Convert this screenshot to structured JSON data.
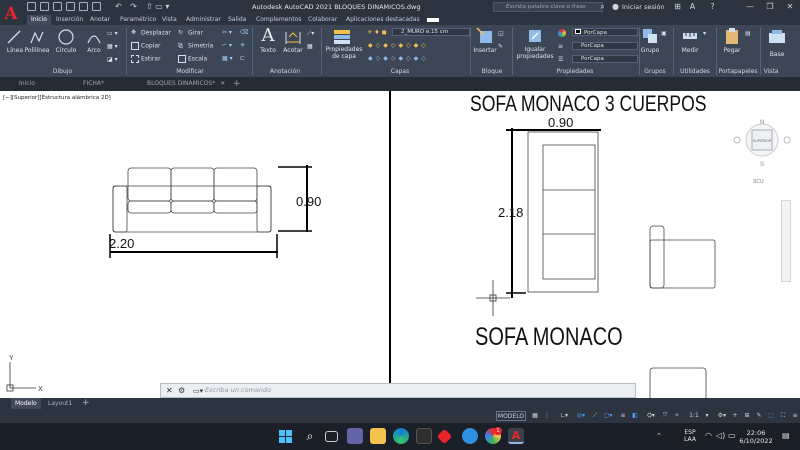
{
  "window": {
    "title": "Autodesk AutoCAD 2021   BLOQUES DINAMICOS.dwg",
    "search_placeholder": "Escriba palabra clave o frase",
    "signin": "Iniciar sesión",
    "logo": "A"
  },
  "ribbon_tabs": [
    "Inicio",
    "Inserción",
    "Anotar",
    "Paramétrico",
    "Vista",
    "Administrar",
    "Salida",
    "Complementos",
    "Colaborar",
    "Aplicaciones destacadas"
  ],
  "ribbon": {
    "dibujo": {
      "label": "Dibujo",
      "linea": "Línea",
      "polilinea": "Polilínea",
      "circulo": "Círculo",
      "arco": "Arco"
    },
    "modificar": {
      "label": "Modificar",
      "desplazar": "Desplazar",
      "girar": "Girar",
      "copiar": "Copiar",
      "simetria": "Simetría",
      "estirar": "Estirar",
      "escala": "Escala"
    },
    "anotacion": {
      "label": "Anotación",
      "texto": "Texto",
      "acotar": "Acotar"
    },
    "capas": {
      "label": "Capas",
      "propiedades": "Propiedades de capa",
      "layer": "2_MURO e.15 cm"
    },
    "bloque": {
      "label": "Bloque",
      "insertar": "Insertar"
    },
    "propiedades": {
      "label": "Propiedades",
      "igualar": "Igualar propiedades",
      "color": "PorCapa",
      "linetype": "PorCapa",
      "lineweight": "PorCapa"
    },
    "grupos": {
      "label": "Grupos",
      "grupo": "Grupo"
    },
    "utilidades": {
      "label": "Utilidades",
      "medir": "Medir"
    },
    "portapapeles": {
      "label": "Portapapeles",
      "pegar": "Pegar"
    },
    "vista": {
      "label": "Vista",
      "base": "Base"
    }
  },
  "file_tabs": [
    "Inicio",
    "FICHA*",
    "BLOQUES DINAMICOS*"
  ],
  "viewport_label": "[−][Superior][Estructura alámbrica 2D]",
  "drawing": {
    "sofa1_width": "2.20",
    "sofa1_depth": "0.90",
    "sofa_title": "SOFA MONACO 3 CUERPOS",
    "sofa2_width": "0.90",
    "sofa2_length": "2.18",
    "sofa_monaco": "SOFA MONACO",
    "ucs_y": "Y",
    "ucs_x": "X"
  },
  "viewcube": {
    "n": "N",
    "s": "S",
    "face": "SUPERIOR",
    "wcs": "SCU"
  },
  "command": {
    "placeholder": "Escriba un comando"
  },
  "layout_tabs": [
    "Modelo",
    "Layout1"
  ],
  "status": {
    "model": "MODELO",
    "scale": "1:1"
  },
  "taskbar": {
    "lang1": "ESP",
    "lang2": "LAA",
    "time": "22:06",
    "date": "6/10/2022",
    "badge": "1"
  },
  "colors": {
    "accent": "#e8252b",
    "ribbon": "#3d4655",
    "titlebar": "#2c3440"
  }
}
